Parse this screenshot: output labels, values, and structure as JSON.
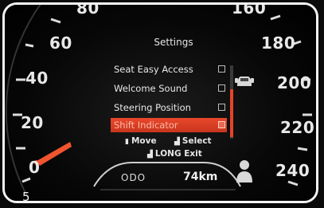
{
  "gauge": {
    "speed_labels_left": [
      "60",
      "40",
      "20",
      "0"
    ],
    "speed_labels_right": [
      "180",
      "200",
      "220",
      "240"
    ],
    "partial_top_left": "80",
    "partial_top_right": "160",
    "needle_color": "#f0552f"
  },
  "settings": {
    "title": "Settings",
    "items": [
      {
        "label": "Seat Easy Access",
        "selected": false
      },
      {
        "label": "Welcome Sound",
        "selected": false
      },
      {
        "label": "Steering Position",
        "selected": false
      },
      {
        "label": "Shift Indicator",
        "selected": true
      }
    ],
    "hints": {
      "move": "Move",
      "select": "Select",
      "long_exit": "LONG Exit"
    },
    "accent_color": "#e2452a"
  },
  "odometer": {
    "label": "ODO",
    "value": "74km"
  },
  "figure_number": "5"
}
